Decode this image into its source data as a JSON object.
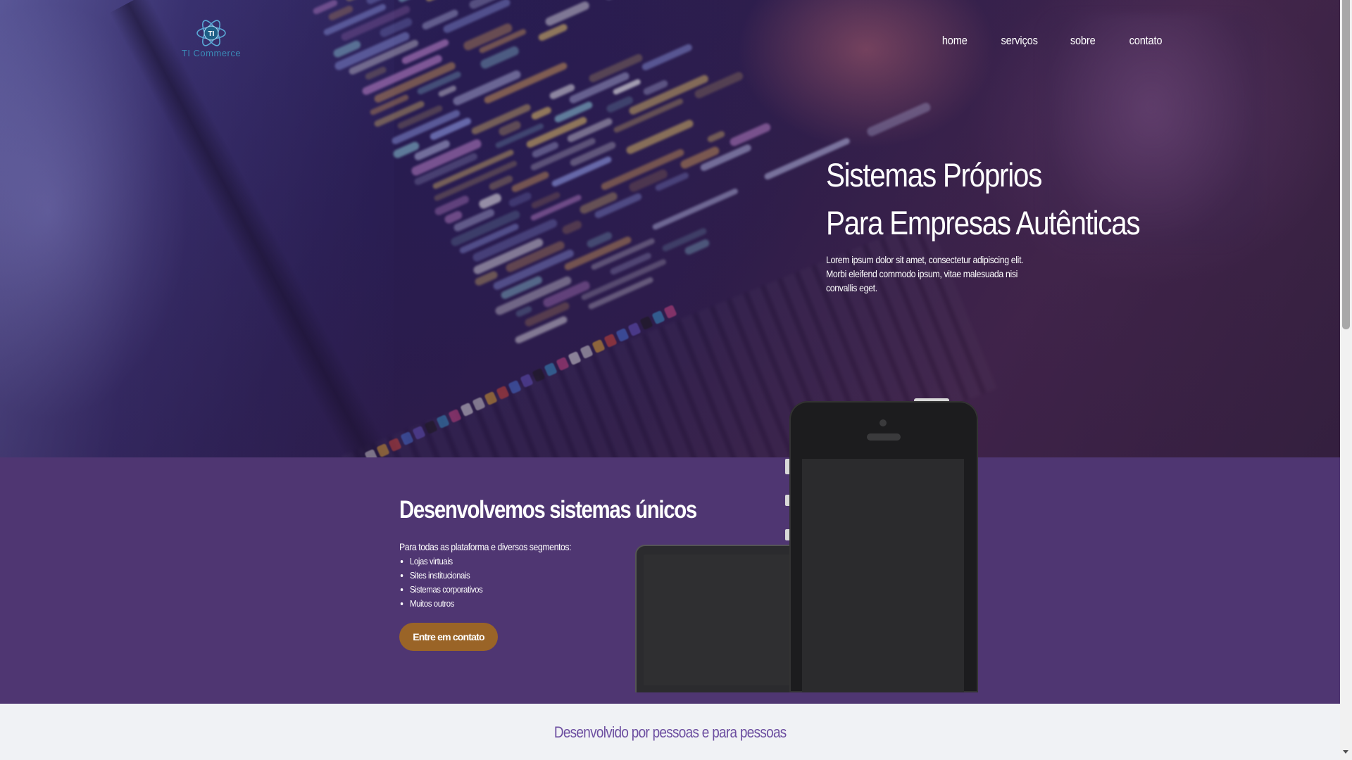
{
  "brand": {
    "logo_badge": "TI",
    "logo_text": "TI Commerce"
  },
  "nav": {
    "items": [
      "home",
      "serviços",
      "sobre",
      "contato"
    ]
  },
  "hero": {
    "title_line1": "Sistemas Próprios",
    "title_line2": "Para Empresas Autênticas",
    "description": "Lorem ipsum dolor sit amet, consectetur adipiscing elit. Morbi eleifend commodo ipsum, vitae malesuada nisi convallis eget."
  },
  "features": {
    "heading": "Desenvolvemos sistemas únicos",
    "intro": "Para todas as plataforma e diversos segmentos:",
    "items": [
      "Lojas virtuais",
      "Sites institucionais",
      "Sistemas corporativos",
      "Muitos outros"
    ],
    "cta_label": "Entre em contato"
  },
  "tagline": "Desenvolvido por pessoas e para pessoas",
  "colors": {
    "section_purple": "#4f3672",
    "cta_brown": "#9a6427",
    "tagline_purple": "#6c4ea0",
    "logo_blue": "#3b8ab7"
  },
  "icons": {
    "logo": "atom-logo-icon",
    "scroll_down": "chevron-down-icon"
  }
}
